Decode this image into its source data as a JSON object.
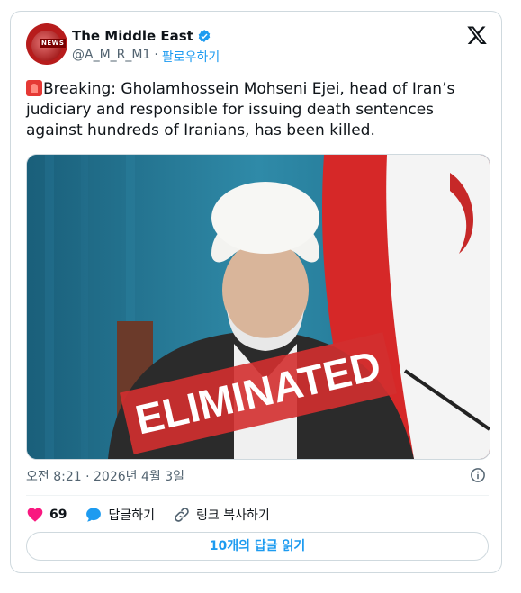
{
  "tweet": {
    "author_name": "The Middle East",
    "handle": "@A_M_R_M1",
    "separator": "·",
    "follow_label": "팔로우하기",
    "avatar_text": "NEWS",
    "text": "Breaking: Gholamhossein Mohseni Ejei, head of Iran’s judiciary and responsible for issuing death sentences against hundreds of Iranians, has been killed.",
    "media_overlay_text": "ELIMINATED",
    "timestamp": "오전 8:21 · 2026년 4월 3일",
    "like_count": "69",
    "reply_label": "답글하기",
    "copy_link_label": "링크 복사하기",
    "read_replies_label": "10개의 답글 읽기"
  },
  "colors": {
    "accent": "#1d9bf0",
    "like": "#f91880",
    "secondary_text": "#536471",
    "border": "#cfd9de"
  },
  "icons": {
    "verified": "verified-badge-icon",
    "brand": "x-logo-icon",
    "info": "info-icon",
    "like": "heart-icon",
    "reply": "speech-bubble-icon",
    "link": "link-icon",
    "alert": "siren-emoji-icon"
  }
}
